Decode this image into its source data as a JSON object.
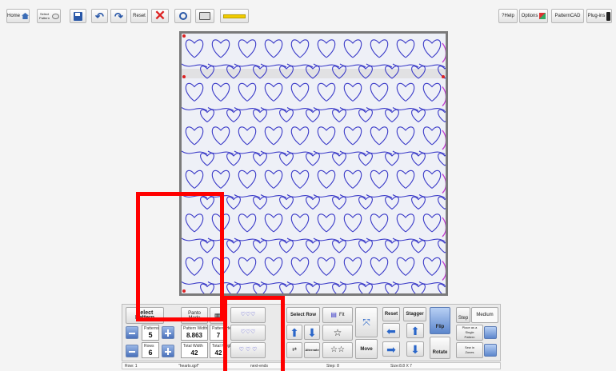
{
  "toolbar": {
    "home_label": "Home",
    "select_pattern_label": "Select Pattern",
    "reset_label": "Reset",
    "help_label": "?Help",
    "options_label": "Options",
    "patterncad_label": "PatternCAD",
    "plugins_label": "Plug-ins"
  },
  "panel": {
    "select_pattern_label": "Select Pattern",
    "panto_mode_label": "Panto Mode",
    "patterns_caption": "Patterns",
    "patterns_value": "5",
    "rows_caption": "Rows",
    "rows_value": "6",
    "pattern_width_caption": "Pattern Width",
    "pattern_width_value": "8.863",
    "pattern_height_caption": "Pattern Height",
    "pattern_height_value": "7",
    "total_width_caption": "Total Width",
    "total_width_value": "42",
    "total_height_caption": "Total Height",
    "total_height_value": "42",
    "select_row_label": "Select Row",
    "alternate_label": "Alternate",
    "fit_label": "Fit",
    "reset_label": "Reset",
    "stagger_label": "Stagger",
    "move_label": "Move",
    "flip_label": "Flip",
    "rotate_label": "Rotate",
    "step_label": "Step",
    "medium_label": "Medium",
    "place_single_label": "Place as a Single Pattern",
    "sew_zones_label": "Sew in Zones"
  },
  "status": {
    "row": "Row: 1",
    "file": "\"hearts.qpf\"",
    "mode": "next-ends",
    "step": "Step: 8",
    "size": "Size:8.8 X 7"
  },
  "colors": {
    "stitch": "#3a3ac8",
    "accent_magenta": "#c03ad0",
    "frame": "#7a7a7a",
    "overlay_red": "#ff0000",
    "toolbar_yellow": "#f1cb00"
  }
}
